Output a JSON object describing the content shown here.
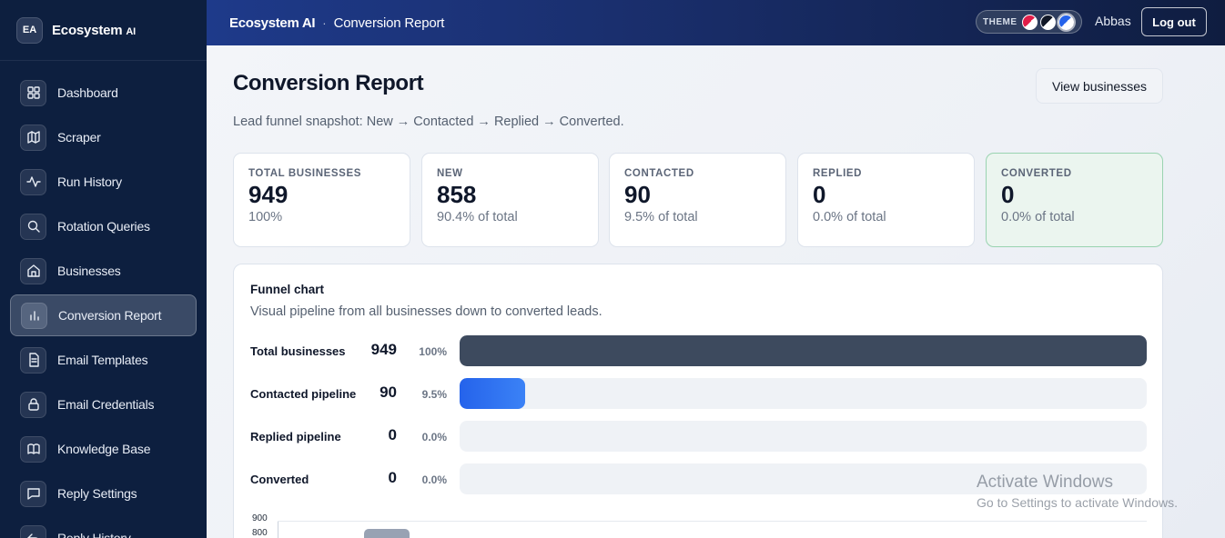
{
  "app": {
    "badge": "EA",
    "name": "Ecosystem",
    "name_suffix": "AI"
  },
  "sidebar": {
    "items": [
      {
        "label": "Dashboard",
        "icon": "grid-icon",
        "active": false
      },
      {
        "label": "Scraper",
        "icon": "map-icon",
        "active": false
      },
      {
        "label": "Run History",
        "icon": "activity-icon",
        "active": false
      },
      {
        "label": "Rotation Queries",
        "icon": "search-icon",
        "active": false
      },
      {
        "label": "Businesses",
        "icon": "home-icon",
        "active": false
      },
      {
        "label": "Conversion Report",
        "icon": "bar-chart-icon",
        "active": true
      },
      {
        "label": "Email Templates",
        "icon": "document-icon",
        "active": false
      },
      {
        "label": "Email Credentials",
        "icon": "lock-icon",
        "active": false
      },
      {
        "label": "Knowledge Base",
        "icon": "book-icon",
        "active": false
      },
      {
        "label": "Reply Settings",
        "icon": "message-icon",
        "active": false
      },
      {
        "label": "Reply History",
        "icon": "reply-icon",
        "active": false
      }
    ]
  },
  "topbar": {
    "app_name": "Ecosystem AI",
    "separator": "·",
    "page": "Conversion Report",
    "theme_label": "THEME",
    "theme_colors": [
      "#e11d48",
      "#111827",
      "#2563eb"
    ],
    "user": "Abbas",
    "logout_label": "Log out"
  },
  "page": {
    "title": "Conversion Report",
    "subtitle": "Lead funnel snapshot: New → Contacted → Replied → Converted.",
    "view_button": "View businesses"
  },
  "cards": [
    {
      "label": "TOTAL BUSINESSES",
      "value": "949",
      "sub": "100%"
    },
    {
      "label": "NEW",
      "value": "858",
      "sub": "90.4% of total"
    },
    {
      "label": "CONTACTED",
      "value": "90",
      "sub": "9.5% of total"
    },
    {
      "label": "REPLIED",
      "value": "0",
      "sub": "0.0% of total"
    },
    {
      "label": "CONVERTED",
      "value": "0",
      "sub": "0.0% of total"
    }
  ],
  "funnel": {
    "title": "Funnel chart",
    "subtitle": "Visual pipeline from all businesses down to converted leads.",
    "rows": [
      {
        "label": "Total businesses",
        "count": "949",
        "pct": "100%",
        "fraction": 1.0,
        "color": "#3d4a5e"
      },
      {
        "label": "Contacted pipeline",
        "count": "90",
        "pct": "9.5%",
        "fraction": 0.095,
        "color": "#2563eb"
      },
      {
        "label": "Replied pipeline",
        "count": "0",
        "pct": "0.0%",
        "fraction": 0.0,
        "color": "#2563eb"
      },
      {
        "label": "Converted",
        "count": "0",
        "pct": "0.0%",
        "fraction": 0.0,
        "color": "#2563eb"
      }
    ]
  },
  "chart_data": {
    "type": "bar",
    "yticks": [
      "900",
      "800"
    ],
    "first_bar_color": "#98a2b3"
  },
  "watermark": {
    "title": "Activate Windows",
    "subtitle": "Go to Settings to activate Windows."
  }
}
